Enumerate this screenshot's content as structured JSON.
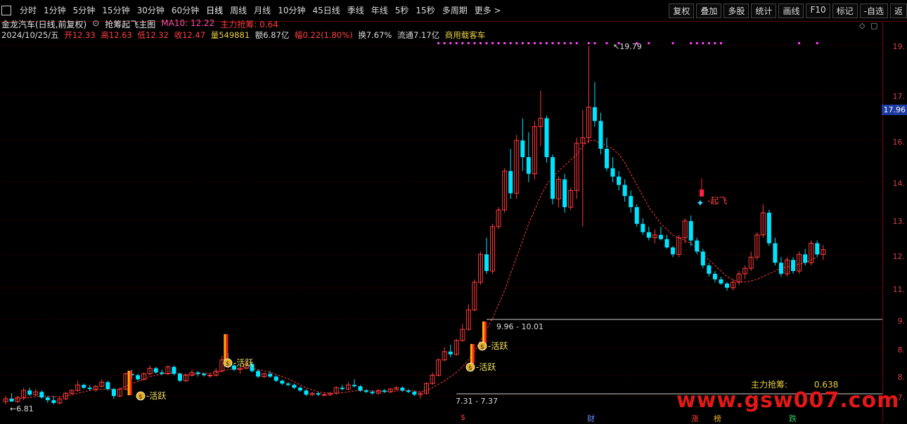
{
  "toolbar": {
    "periods": [
      "分时",
      "1分钟",
      "5分钟",
      "15分钟",
      "30分钟",
      "60分钟",
      "日线",
      "周线",
      "月线",
      "10分钟",
      "45日线",
      "季线",
      "年线",
      "5秒",
      "15秒",
      "多周期",
      "更多 >"
    ],
    "right_buttons": [
      "复权",
      "叠加",
      "多股",
      "统计",
      "画线",
      "F10",
      "标记",
      "-自选",
      "返"
    ]
  },
  "header": {
    "stock_title": "金龙汽车(日线,前复权)",
    "indicator_name": "抢筹起飞主图",
    "ma_label": "MA10: 12.22",
    "main_grab_label": "主力抢筹: 0.64"
  },
  "quote": {
    "date": "2024/10/25/五",
    "open": "开12.33",
    "high": "高12.63",
    "low": "低12.32",
    "close": "收12.47",
    "volume": "量549881",
    "amount": "额6.87亿",
    "change": "幅0.22(1.80%)",
    "turnover": "换7.67%",
    "float_cap": "流通7.17亿",
    "industry": "商用载客车"
  },
  "axis": {
    "ticks": [
      "19.",
      "17.",
      "16.",
      "14.",
      "13.",
      "12.",
      "11.",
      "9.",
      "8.",
      "8.",
      "7."
    ],
    "current_price": "17.96"
  },
  "annotations": {
    "high_label": "19.79",
    "low_label": "6.81",
    "range1": "9.96 - 10.01",
    "range2": "7.31 - 7.37",
    "active": "活跃",
    "takeoff": "起飞"
  },
  "legend": {
    "label": "主力抢筹:",
    "value": "0.638"
  },
  "bottom_markers": [
    "$",
    "财",
    "涨",
    "榜",
    "跌"
  ],
  "watermark": "www.gsw007.com",
  "colors": {
    "up": "#ff3b3b",
    "down": "#00e5ff",
    "ma": "#ff3b3b",
    "dots": "#ff40ff",
    "bg": "#000000",
    "gold": "#e8d040"
  },
  "chart_data": {
    "type": "candlestick",
    "series": [
      {
        "name": "K线",
        "ohlc": [
          [
            7.0,
            7.2,
            6.9,
            7.1
          ],
          [
            7.1,
            7.3,
            7.0,
            7.0
          ],
          [
            7.0,
            7.2,
            6.95,
            7.15
          ],
          [
            7.15,
            7.5,
            7.05,
            7.4
          ],
          [
            7.4,
            7.5,
            7.2,
            7.25
          ],
          [
            7.25,
            7.45,
            7.2,
            7.35
          ],
          [
            7.35,
            7.4,
            7.1,
            7.15
          ],
          [
            7.15,
            7.2,
            6.95,
            7.05
          ],
          [
            7.05,
            7.2,
            6.9,
            6.95
          ],
          [
            6.95,
            7.15,
            6.9,
            7.1
          ],
          [
            7.1,
            7.35,
            7.05,
            7.3
          ],
          [
            7.3,
            7.45,
            7.25,
            7.4
          ],
          [
            7.4,
            7.75,
            7.35,
            7.6
          ],
          [
            7.6,
            7.65,
            7.45,
            7.5
          ],
          [
            7.5,
            7.6,
            7.4,
            7.45
          ],
          [
            7.45,
            7.6,
            7.35,
            7.55
          ],
          [
            7.55,
            7.8,
            7.5,
            7.7
          ],
          [
            7.7,
            7.75,
            7.4,
            7.45
          ],
          [
            7.45,
            7.5,
            7.1,
            7.2
          ],
          [
            7.2,
            7.5,
            7.15,
            7.45
          ],
          [
            7.45,
            8.05,
            7.4,
            8.0
          ],
          [
            8.0,
            8.15,
            7.85,
            7.95
          ],
          [
            7.95,
            8.0,
            7.75,
            7.8
          ],
          [
            7.8,
            8.05,
            7.75,
            8.0
          ],
          [
            8.0,
            8.3,
            7.95,
            8.2
          ],
          [
            8.2,
            8.25,
            8.0,
            8.05
          ],
          [
            8.05,
            8.15,
            7.95,
            8.0
          ],
          [
            8.0,
            8.3,
            7.95,
            8.25
          ],
          [
            8.25,
            8.3,
            7.95,
            8.0
          ],
          [
            8.0,
            8.05,
            7.7,
            7.75
          ],
          [
            7.75,
            8.0,
            7.7,
            7.95
          ],
          [
            7.95,
            8.15,
            7.9,
            8.05
          ],
          [
            8.05,
            8.1,
            7.9,
            8.0
          ],
          [
            8.0,
            8.05,
            7.9,
            7.95
          ],
          [
            7.95,
            8.0,
            7.85,
            7.95
          ],
          [
            7.95,
            8.2,
            7.9,
            8.1
          ],
          [
            8.1,
            8.65,
            8.05,
            8.5
          ],
          [
            8.5,
            8.75,
            8.2,
            8.3
          ],
          [
            8.3,
            8.35,
            8.1,
            8.15
          ],
          [
            8.15,
            8.25,
            8.0,
            8.2
          ],
          [
            8.2,
            8.45,
            8.15,
            8.35
          ],
          [
            8.35,
            8.4,
            8.05,
            8.1
          ],
          [
            8.1,
            8.15,
            7.85,
            7.9
          ],
          [
            7.9,
            8.05,
            7.85,
            8.0
          ],
          [
            8.0,
            8.1,
            7.85,
            7.9
          ],
          [
            7.9,
            7.95,
            7.7,
            7.75
          ],
          [
            7.75,
            7.8,
            7.6,
            7.65
          ],
          [
            7.65,
            7.7,
            7.55,
            7.6
          ],
          [
            7.6,
            7.65,
            7.45,
            7.5
          ],
          [
            7.5,
            7.55,
            7.35,
            7.4
          ],
          [
            7.4,
            7.45,
            7.2,
            7.25
          ],
          [
            7.25,
            7.35,
            7.2,
            7.3
          ],
          [
            7.3,
            7.35,
            7.2,
            7.25
          ],
          [
            7.25,
            7.3,
            7.2,
            7.25
          ],
          [
            7.25,
            7.35,
            7.2,
            7.3
          ],
          [
            7.3,
            7.55,
            7.25,
            7.5
          ],
          [
            7.5,
            7.6,
            7.4,
            7.45
          ],
          [
            7.45,
            7.7,
            7.4,
            7.6
          ],
          [
            7.6,
            7.8,
            7.5,
            7.55
          ],
          [
            7.55,
            7.6,
            7.35,
            7.4
          ],
          [
            7.4,
            7.45,
            7.3,
            7.35
          ],
          [
            7.35,
            7.4,
            7.25,
            7.3
          ],
          [
            7.3,
            7.45,
            7.25,
            7.4
          ],
          [
            7.4,
            7.45,
            7.3,
            7.35
          ],
          [
            7.35,
            7.5,
            7.3,
            7.45
          ],
          [
            7.45,
            7.55,
            7.4,
            7.5
          ],
          [
            7.5,
            7.55,
            7.35,
            7.4
          ],
          [
            7.4,
            7.45,
            7.3,
            7.35
          ],
          [
            7.35,
            7.4,
            7.2,
            7.25
          ],
          [
            7.25,
            7.35,
            7.1,
            7.3
          ],
          [
            7.3,
            7.7,
            7.25,
            7.65
          ],
          [
            7.65,
            8.05,
            7.6,
            7.95
          ],
          [
            7.95,
            8.55,
            7.9,
            8.5
          ],
          [
            8.5,
            8.95,
            8.45,
            8.8
          ],
          [
            8.8,
            9.05,
            8.6,
            8.7
          ],
          [
            8.7,
            9.25,
            8.65,
            9.2
          ],
          [
            9.2,
            9.8,
            9.15,
            9.6
          ],
          [
            9.6,
            10.5,
            9.55,
            10.3
          ],
          [
            10.3,
            11.4,
            10.25,
            11.3
          ],
          [
            11.3,
            12.4,
            11.2,
            12.3
          ],
          [
            12.3,
            12.9,
            11.6,
            11.7
          ],
          [
            11.7,
            13.4,
            11.6,
            13.3
          ],
          [
            13.3,
            14.0,
            13.2,
            13.9
          ],
          [
            13.9,
            15.4,
            13.8,
            15.3
          ],
          [
            15.3,
            16.1,
            14.3,
            14.5
          ],
          [
            14.5,
            16.6,
            14.3,
            16.4
          ],
          [
            16.4,
            17.2,
            15.3,
            15.8
          ],
          [
            15.8,
            16.7,
            14.9,
            15.2
          ],
          [
            15.2,
            17.1,
            15.0,
            16.9
          ],
          [
            16.9,
            18.2,
            16.2,
            17.2
          ],
          [
            17.2,
            17.3,
            15.6,
            15.8
          ],
          [
            15.8,
            15.9,
            14.1,
            14.3
          ],
          [
            14.3,
            15.1,
            14.0,
            15.0
          ],
          [
            15.0,
            15.2,
            13.8,
            14.0
          ],
          [
            14.0,
            14.7,
            13.9,
            14.6
          ],
          [
            14.6,
            16.5,
            14.3,
            16.3
          ],
          [
            16.3,
            17.5,
            13.3,
            16.5
          ],
          [
            16.5,
            19.79,
            16.3,
            17.6
          ],
          [
            17.6,
            18.5,
            16.9,
            17.1
          ],
          [
            17.1,
            17.4,
            15.9,
            16.1
          ],
          [
            16.1,
            16.5,
            15.3,
            15.4
          ],
          [
            15.4,
            15.8,
            14.9,
            15.1
          ],
          [
            15.1,
            15.3,
            14.6,
            14.8
          ],
          [
            14.8,
            15.0,
            14.2,
            14.4
          ],
          [
            14.4,
            14.6,
            13.8,
            14.0
          ],
          [
            14.0,
            14.1,
            13.3,
            13.4
          ],
          [
            13.4,
            13.6,
            13.0,
            13.1
          ],
          [
            13.1,
            13.3,
            12.8,
            12.9
          ],
          [
            12.9,
            13.2,
            12.7,
            13.0
          ],
          [
            13.0,
            13.3,
            12.8,
            12.85
          ],
          [
            12.85,
            13.0,
            12.5,
            12.55
          ],
          [
            12.55,
            12.6,
            12.2,
            12.3
          ],
          [
            12.3,
            13.0,
            12.2,
            12.9
          ],
          [
            12.9,
            13.6,
            12.7,
            13.5
          ],
          [
            13.5,
            13.7,
            12.6,
            12.8
          ],
          [
            12.8,
            12.9,
            12.3,
            12.4
          ],
          [
            12.4,
            12.5,
            11.8,
            11.9
          ],
          [
            11.9,
            12.0,
            11.5,
            11.6
          ],
          [
            11.6,
            11.7,
            11.3,
            11.4
          ],
          [
            11.4,
            11.5,
            11.2,
            11.25
          ],
          [
            11.25,
            11.3,
            11.0,
            11.1
          ],
          [
            11.1,
            11.4,
            11.0,
            11.3
          ],
          [
            11.3,
            11.7,
            11.2,
            11.6
          ],
          [
            11.6,
            11.9,
            11.4,
            11.8
          ],
          [
            11.8,
            12.4,
            11.7,
            12.2
          ],
          [
            12.2,
            13.1,
            12.1,
            13.0
          ],
          [
            13.0,
            14.1,
            12.9,
            13.8
          ],
          [
            13.8,
            13.9,
            12.6,
            12.7
          ],
          [
            12.7,
            12.9,
            11.9,
            12.0
          ],
          [
            12.0,
            12.2,
            11.5,
            11.6
          ],
          [
            11.6,
            12.2,
            11.5,
            12.1
          ],
          [
            12.1,
            12.2,
            11.6,
            11.7
          ],
          [
            11.7,
            12.4,
            11.6,
            12.3
          ],
          [
            12.3,
            12.5,
            11.9,
            12.0
          ],
          [
            12.0,
            12.8,
            11.9,
            12.7
          ],
          [
            12.7,
            12.8,
            12.2,
            12.3
          ],
          [
            12.3,
            12.63,
            12.1,
            12.47
          ]
        ]
      },
      {
        "name": "MA10",
        "values": [
          7.1,
          7.1,
          7.1,
          7.12,
          7.15,
          7.18,
          7.2,
          7.2,
          7.18,
          7.17,
          7.2,
          7.25,
          7.3,
          7.35,
          7.4,
          7.42,
          7.45,
          7.45,
          7.42,
          7.45,
          7.55,
          7.65,
          7.72,
          7.8,
          7.9,
          7.95,
          8.0,
          8.02,
          8.02,
          8.0,
          7.98,
          7.98,
          8.0,
          8.02,
          8.02,
          8.05,
          8.1,
          8.15,
          8.18,
          8.2,
          8.22,
          8.2,
          8.15,
          8.1,
          8.05,
          7.98,
          7.9,
          7.82,
          7.72,
          7.6,
          7.5,
          7.42,
          7.35,
          7.32,
          7.3,
          7.3,
          7.32,
          7.35,
          7.38,
          7.4,
          7.4,
          7.38,
          7.36,
          7.36,
          7.36,
          7.38,
          7.4,
          7.4,
          7.38,
          7.35,
          7.4,
          7.5,
          7.62,
          7.75,
          7.9,
          8.05,
          8.25,
          8.5,
          8.8,
          9.2,
          9.6,
          10.0,
          10.5,
          11.0,
          11.6,
          12.2,
          12.8,
          13.4,
          13.9,
          14.4,
          14.8,
          15.1,
          15.3,
          15.5,
          15.7,
          15.9,
          16.2,
          16.4,
          16.4,
          16.3,
          16.2,
          16.1,
          15.9,
          15.6,
          15.2,
          14.8,
          14.4,
          14.0,
          13.7,
          13.4,
          13.2,
          13.0,
          12.9,
          12.8,
          12.7,
          12.5,
          12.3,
          12.1,
          11.9,
          11.7,
          11.5,
          11.4,
          11.3,
          11.3,
          11.35,
          11.4,
          11.5,
          11.6,
          11.7,
          11.8,
          11.85,
          11.9,
          11.95,
          12.0,
          12.1,
          12.2
        ]
      }
    ],
    "ylim": [
      6.5,
      20.0
    ],
    "grid": true,
    "labels": [
      "19.79",
      "6.81",
      "9.96 - 10.01",
      "7.31 - 7.37"
    ]
  }
}
